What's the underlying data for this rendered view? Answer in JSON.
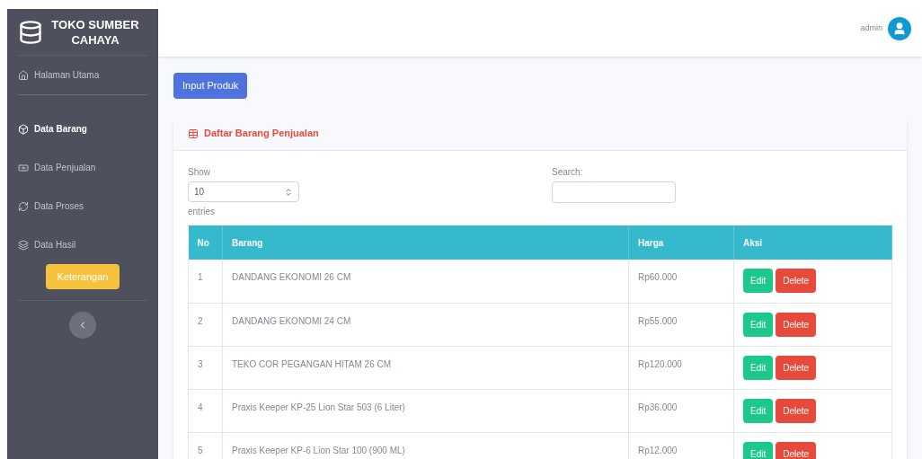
{
  "brand": {
    "title": "TOKO SUMBER CAHAYA"
  },
  "sidebar": {
    "items": [
      {
        "label": "Halaman Utama",
        "selected": false
      },
      {
        "label": "Data Barang",
        "selected": true
      },
      {
        "label": "Data Penjualan",
        "selected": false
      },
      {
        "label": "Data Proses",
        "selected": false
      },
      {
        "label": "Data Hasil",
        "selected": false
      }
    ],
    "button": "Keterangan"
  },
  "topbar": {
    "user": "admin"
  },
  "input_button": "Input Produk",
  "card": {
    "title": "Daftar Barang Penjualan",
    "length": {
      "before": "Show",
      "value": "10",
      "after": "entries"
    },
    "search": {
      "label": "Search:"
    },
    "table": {
      "columns": [
        "No",
        "Barang",
        "Harga",
        "Aksi"
      ],
      "rows": [
        {
          "no": "1",
          "barang": "DANDANG EKONOMI 26 CM",
          "harga": "Rp60.000",
          "actions": [
            "Edit",
            "Delete"
          ]
        },
        {
          "no": "2",
          "barang": "DANDANG EKONOMI 24 CM",
          "harga": "Rp55.000",
          "actions": [
            "Edit",
            "Delete"
          ]
        },
        {
          "no": "3",
          "barang": "TEKO COR PEGANGAN HITAM 26 CM",
          "harga": "Rp120.000",
          "actions": [
            "Edit",
            "Delete"
          ]
        },
        {
          "no": "4",
          "barang": "Praxis Keeper KP-25 Lion Star 503 (6 Liter)",
          "harga": "Rp36.000",
          "actions": [
            "Edit",
            "Delete"
          ]
        },
        {
          "no": "5",
          "barang": "Praxis Keeper KP-6 Lion Star 100 (900 ML)",
          "harga": "Rp12.000",
          "actions": [
            "Edit",
            "Delete"
          ]
        }
      ]
    }
  }
}
